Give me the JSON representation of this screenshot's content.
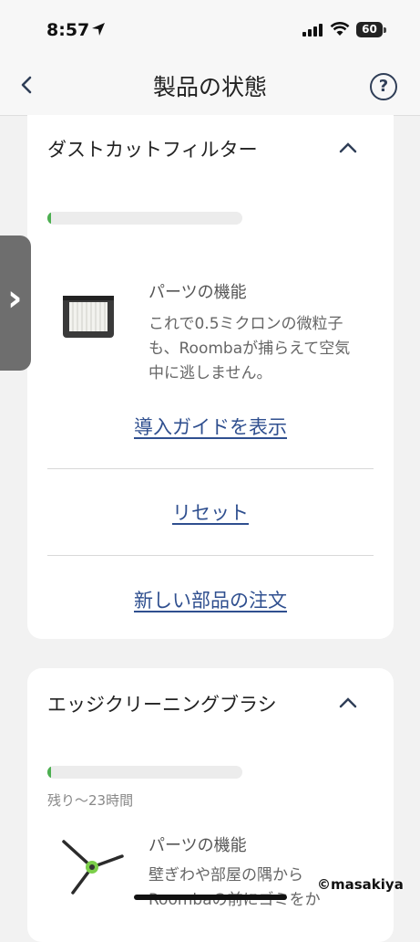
{
  "status_bar": {
    "time": "8:57",
    "battery": "60"
  },
  "nav": {
    "title": "製品の状態",
    "help_icon": "question-circle-icon"
  },
  "cards": [
    {
      "title": "ダストカットフィルター",
      "progress_fraction": 0.02,
      "function_label": "パーツの機能",
      "function_desc": "これで0.5ミクロンの微粒子も、Roombaが捕らえて空気中に逃しません。",
      "links": [
        "導入ガイドを表示",
        "リセット",
        "新しい部品の注文"
      ]
    },
    {
      "title": "エッジクリーニングブラシ",
      "progress_fraction": 0.02,
      "remaining": "残り〜23時間",
      "function_label": "パーツの機能",
      "function_desc": "壁ぎわや部屋の隅からRoombaの前にゴミをか"
    }
  ],
  "watermark": "©masakiya",
  "colors": {
    "progress": "#4caf50",
    "link": "#2f4f8f",
    "accent": "#2f3e57"
  }
}
